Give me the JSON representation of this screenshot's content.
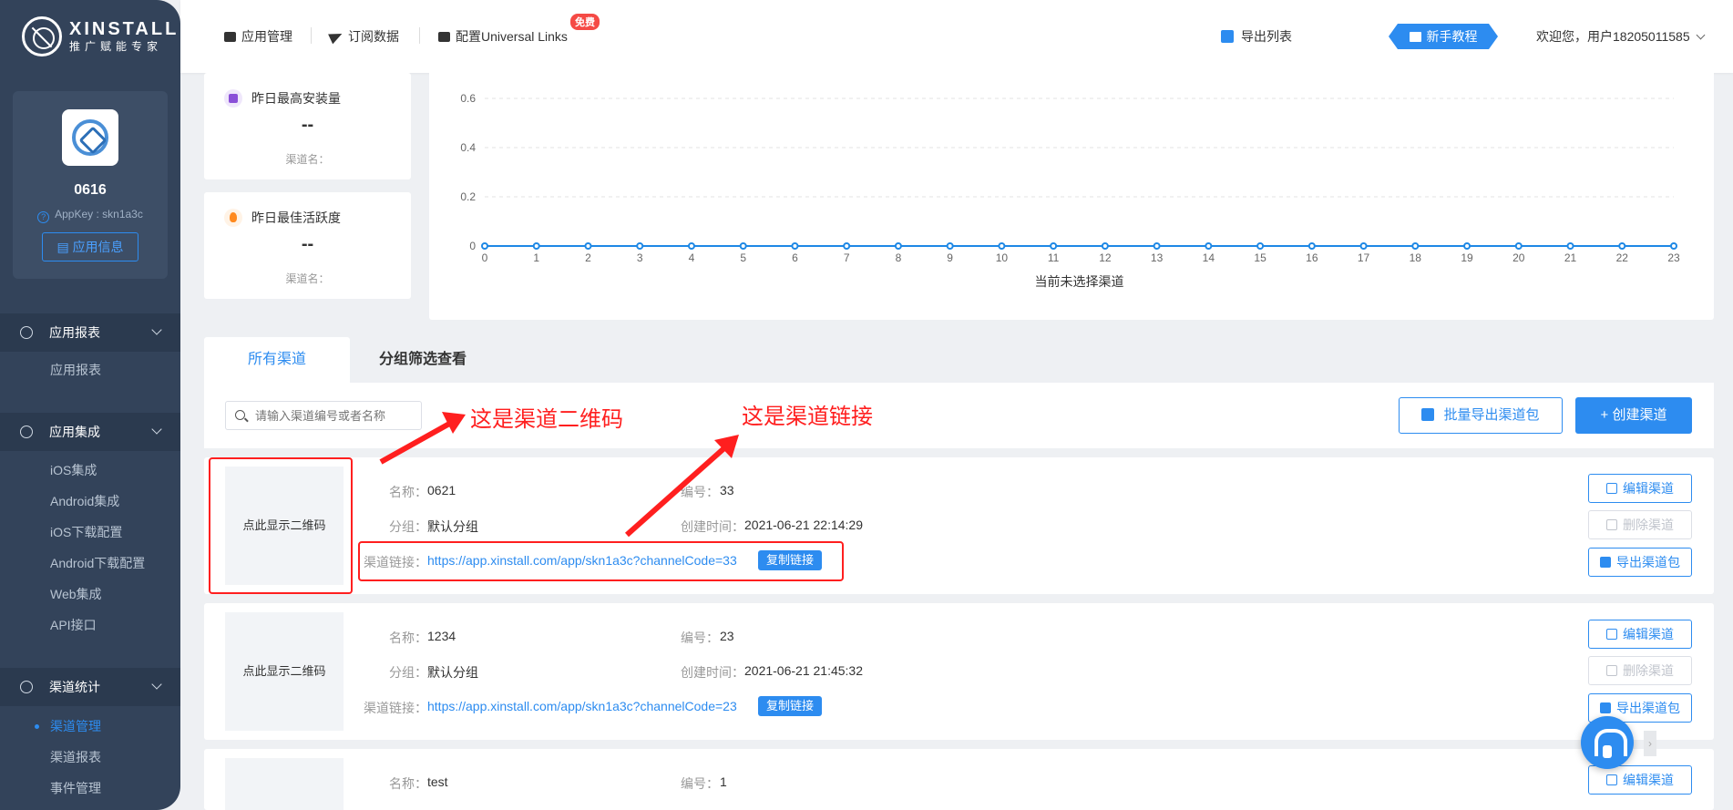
{
  "brand": {
    "name": "XINSTALL",
    "tagline": "推广赋能专家"
  },
  "app": {
    "name": "0616",
    "appkey": "AppKey : skn1a3c",
    "info_button": "应用信息"
  },
  "sidebar": {
    "groups": [
      {
        "label": "应用报表",
        "items": [
          "应用报表"
        ]
      },
      {
        "label": "应用集成",
        "items": [
          "iOS集成",
          "Android集成",
          "iOS下载配置",
          "Android下载配置",
          "Web集成",
          "API接口"
        ]
      },
      {
        "label": "渠道统计",
        "items": [
          "渠道管理",
          "渠道报表",
          "事件管理"
        ]
      }
    ]
  },
  "topbar": {
    "nav": [
      "应用管理",
      "订阅数据",
      "配置Universal Links"
    ],
    "free_badge": "免费",
    "export_list": "导出列表",
    "tutorial": "新手教程",
    "welcome": "欢迎您，用户18205011585"
  },
  "stats": [
    {
      "title": "昨日最高安装量",
      "value": "--",
      "sub": "渠道名："
    },
    {
      "title": "昨日最佳活跃度",
      "value": "--",
      "sub": "渠道名："
    }
  ],
  "chart_data": {
    "type": "line",
    "x": [
      0,
      1,
      2,
      3,
      4,
      5,
      6,
      7,
      8,
      9,
      10,
      11,
      12,
      13,
      14,
      15,
      16,
      17,
      18,
      19,
      20,
      21,
      22,
      23
    ],
    "series": [
      {
        "values": [
          0,
          0,
          0,
          0,
          0,
          0,
          0,
          0,
          0,
          0,
          0,
          0,
          0,
          0,
          0,
          0,
          0,
          0,
          0,
          0,
          0,
          0,
          0,
          0
        ]
      }
    ],
    "yticks": [
      "0",
      "0.2",
      "0.4",
      "0.6",
      "0.8"
    ],
    "ylim": [
      0,
      0.8
    ],
    "xlabel": "当前未选择渠道",
    "grid": true,
    "color": "#1e88e5"
  },
  "tabs": [
    "所有渠道",
    "分组筛选查看"
  ],
  "toolbar": {
    "search_placeholder": "请输入渠道编号或者名称",
    "batch_export": "批量导出渠道包",
    "create": "+ 创建渠道"
  },
  "labels": {
    "name": "名称：",
    "code": "编号：",
    "group": "分组：",
    "created": "创建时间：",
    "link": "渠道链接：",
    "show_qr": "点此显示二维码",
    "copy": "复制链接",
    "edit": "编辑渠道",
    "delete": "删除渠道",
    "export": "导出渠道包"
  },
  "channels": [
    {
      "name": "0621",
      "code": "33",
      "group": "默认分组",
      "created": "2021-06-21 22:14:29",
      "link": "https://app.xinstall.com/app/skn1a3c?channelCode=33"
    },
    {
      "name": "1234",
      "code": "23",
      "group": "默认分组",
      "created": "2021-06-21 21:45:32",
      "link": "https://app.xinstall.com/app/skn1a3c?channelCode=23"
    },
    {
      "name": "test",
      "code": "1"
    }
  ],
  "annotations": {
    "qr_note": "这是渠道二维码",
    "link_note": "这是渠道链接"
  }
}
